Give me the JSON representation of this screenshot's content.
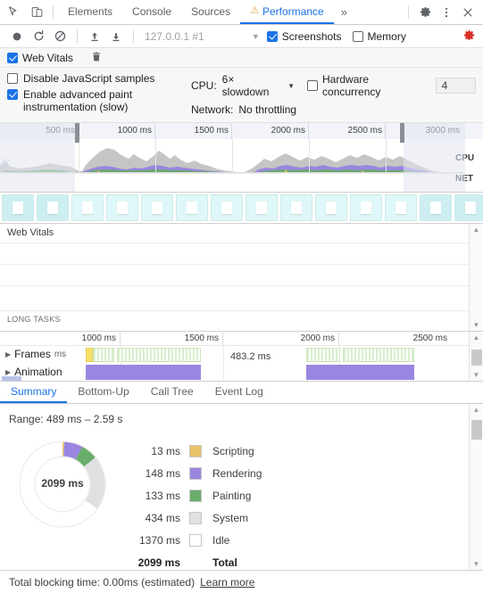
{
  "devtools": {
    "icons": {
      "inspect": "inspect-element-icon",
      "device": "device-toolbar-icon",
      "more_tabs": "»",
      "settings": "gear-icon",
      "kebab": "more-options-icon",
      "close": "close-icon"
    },
    "tabs": [
      {
        "label": "Elements",
        "active": false,
        "warning": false
      },
      {
        "label": "Console",
        "active": false,
        "warning": false
      },
      {
        "label": "Sources",
        "active": false,
        "warning": false
      },
      {
        "label": "Performance",
        "active": true,
        "warning": true,
        "warning_glyph": "⚠"
      }
    ]
  },
  "record_toolbar": {
    "record_label": "record-button",
    "reload_label": "reload-and-record-button",
    "clear_label": "clear-recording-button",
    "upload_label": "upload-profile-button",
    "download_label": "download-profile-button",
    "target": "127.0.0.1 #1",
    "target_caret": "▼",
    "screenshots_label": "Screenshots",
    "screenshots_checked": true,
    "memory_label": "Memory",
    "memory_checked": false,
    "capture_settings_icon": "capture-settings-gear-icon"
  },
  "capture_settings": {
    "web_vitals_label": "Web Vitals",
    "web_vitals_checked": true,
    "trash_icon": "delete-icon",
    "disable_js_label": "Disable JavaScript samples",
    "disable_js_checked": false,
    "advanced_paint_label": "Enable advanced paint instrumentation (slow)",
    "advanced_paint_checked": true,
    "cpu_label": "CPU:",
    "cpu_value": "6× slowdown",
    "cpu_caret": "▼",
    "hardware_concurrency_label": "Hardware concurrency",
    "hardware_concurrency_checked": false,
    "hardware_concurrency_value": "4",
    "network_label": "Network:",
    "network_value": "No throttling"
  },
  "overview": {
    "ticks": [
      "500 ms",
      "1000 ms",
      "1500 ms",
      "2000 ms",
      "2500 ms",
      "3000 ms"
    ],
    "cpu_label": "CPU",
    "net_label": "NET",
    "colors": {
      "system": "#c8c8c8",
      "rendering": "#9a86e0",
      "painting": "#69ad6b",
      "scripting": "#e8c36a"
    }
  },
  "filmstrip": {
    "thumb_count": 15,
    "thumb_name": "screenshot-thumbnail"
  },
  "tracks": {
    "web_vitals_title": "Web Vitals",
    "long_tasks_title": "LONG TASKS"
  },
  "flame": {
    "ticks": [
      "1000 ms",
      "1500 ms",
      "2000 ms",
      "2500 ms"
    ],
    "rows": [
      {
        "label": "Frames",
        "unit": "ms",
        "expander": "▶"
      },
      {
        "label": "Animation",
        "unit": "",
        "expander": "▶"
      }
    ],
    "frame_duration_label": "483.2 ms"
  },
  "detail_tabs": [
    {
      "label": "Summary",
      "active": true
    },
    {
      "label": "Bottom-Up",
      "active": false
    },
    {
      "label": "Call Tree",
      "active": false
    },
    {
      "label": "Event Log",
      "active": false
    }
  ],
  "summary": {
    "range": "Range: 489 ms – 2.59 s",
    "donut_center": "2099 ms",
    "total_label": "Total",
    "total_value": "2099 ms"
  },
  "chart_data": {
    "type": "pie",
    "title": "Performance summary donut",
    "center_label": "2099 ms",
    "unit": "ms",
    "categories": [
      "Scripting",
      "Rendering",
      "Painting",
      "System",
      "Idle"
    ],
    "values": [
      13,
      148,
      133,
      434,
      1370
    ],
    "value_labels": [
      "13 ms",
      "148 ms",
      "133 ms",
      "434 ms",
      "1370 ms"
    ],
    "colors": [
      "#e8c36a",
      "#9a86e0",
      "#69ad6b",
      "#e0e0e0",
      "#ffffff"
    ],
    "total": 2099,
    "total_label": "2099 ms",
    "legend_position": "right",
    "start_angle_deg": 0
  },
  "footer": {
    "blocking_text": "Total blocking time: 0.00ms (estimated)",
    "learn_more": "Learn more"
  }
}
